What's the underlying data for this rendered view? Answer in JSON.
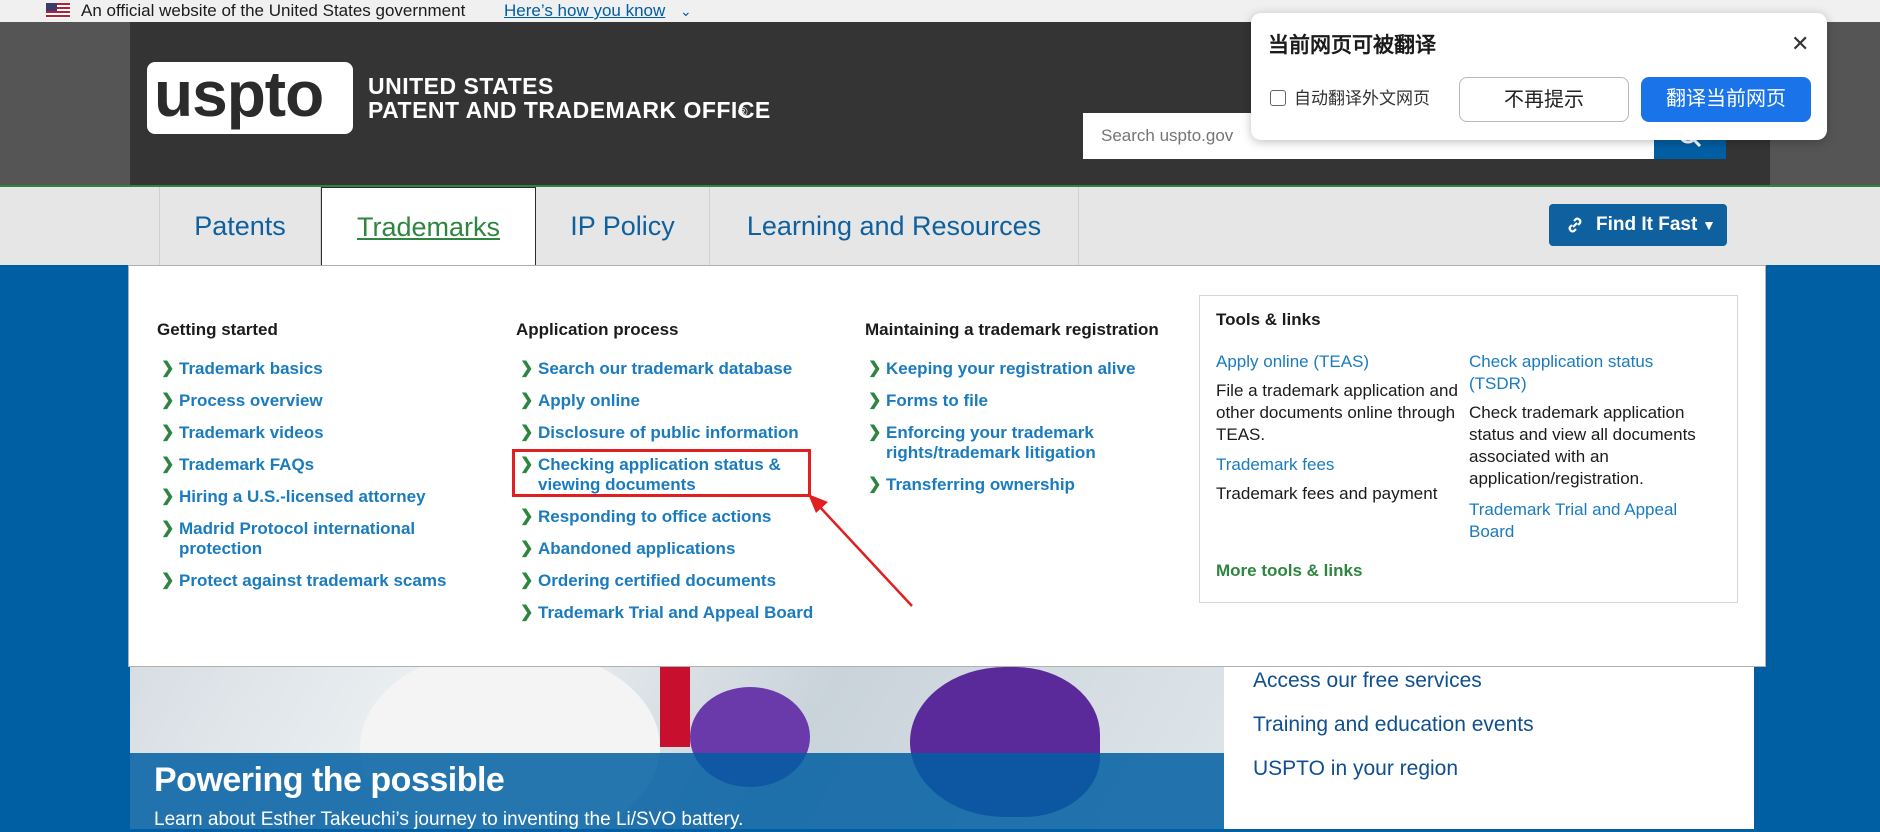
{
  "gov_banner": {
    "text": "An official website of the United States government",
    "link": "Here’s how you know",
    "chevron": "⌄"
  },
  "header": {
    "logo_text": "uspto",
    "office_line1": "UNITED STATES",
    "office_line2": "PATENT AND TRADEMARK OFFICE",
    "registered_mark": "®",
    "search_placeholder": "Search uspto.gov",
    "search_icon": "search-icon"
  },
  "nav": {
    "tabs": [
      {
        "label": "Patents",
        "active": false
      },
      {
        "label": "Trademarks",
        "active": true
      },
      {
        "label": "IP Policy",
        "active": false
      },
      {
        "label": "Learning and Resources",
        "active": false
      }
    ],
    "find_it_fast": "Find It Fast",
    "find_it_fast_icon": "link-icon"
  },
  "mega_menu": {
    "getting_started": {
      "heading": "Getting started",
      "links": [
        "Trademark basics",
        "Process overview",
        "Trademark videos",
        "Trademark FAQs",
        "Hiring a U.S.-licensed attorney",
        "Madrid Protocol international protection",
        "Protect against trademark scams"
      ]
    },
    "application_process": {
      "heading": "Application process",
      "links": [
        "Search our trademark database",
        "Apply online",
        "Disclosure of public information",
        "Checking application status & viewing documents",
        "Responding to office actions",
        "Abandoned applications",
        "Ordering certified documents",
        "Trademark Trial and Appeal Board"
      ]
    },
    "maintaining": {
      "heading": "Maintaining a trademark registration",
      "links": [
        "Keeping your registration alive",
        "Forms to file",
        "Enforcing your trademark rights/trademark litigation",
        "Transferring ownership"
      ]
    },
    "tools": {
      "heading": "Tools & links",
      "items": [
        {
          "label": "Apply online (TEAS)",
          "desc": "File a trademark application and other documents online through TEAS."
        },
        {
          "label": "Trademark fees",
          "desc": "Trademark fees and payment"
        },
        {
          "label": "Check application status (TSDR)",
          "desc": "Check trademark application status and view all documents associated with an application/registration."
        },
        {
          "label": "Trademark Trial and Appeal Board",
          "desc": ""
        }
      ],
      "more": "More tools & links"
    }
  },
  "hero": {
    "title": "Powering the possible",
    "description": "Learn about Esther Takeuchi’s journey to inventing the Li/SVO battery."
  },
  "side_links": [
    "Access our free services",
    "Training and education events",
    "USPTO in your region"
  ],
  "translate_popup": {
    "title": "当前网页可被翻译",
    "close": "✕",
    "checkbox_label": "自动翻译外文网页",
    "checkbox_checked": false,
    "no_remind": "不再提示",
    "translate": "翻译当前网页"
  },
  "colors": {
    "accent_green": "#2e8540",
    "link_blue": "#1a7bbf",
    "brand_blue": "#005ea2",
    "annotation_red": "#e02020",
    "translate_blue": "#1a73e8"
  }
}
